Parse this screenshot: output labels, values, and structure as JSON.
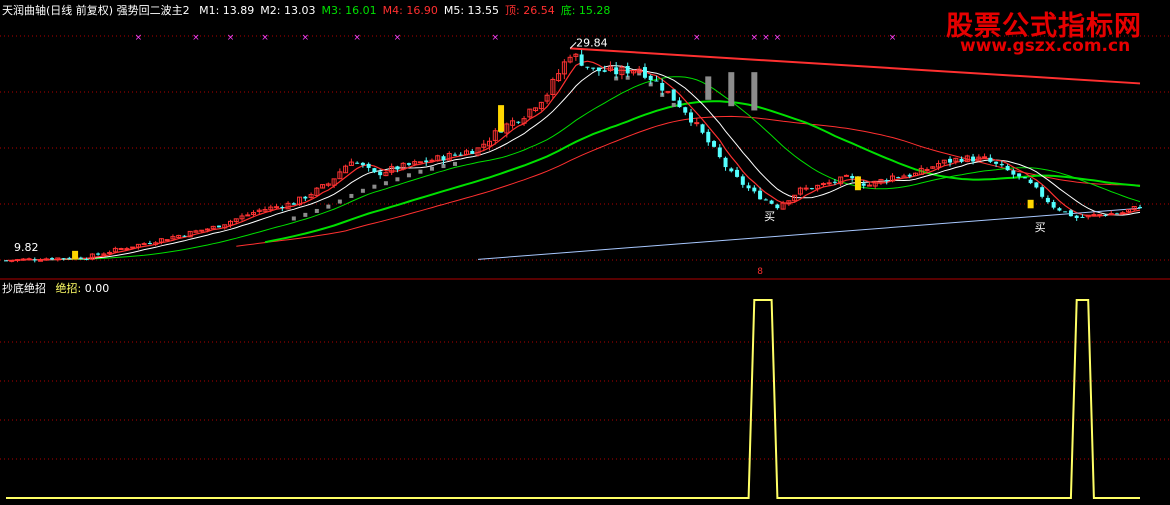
{
  "header_main": {
    "name": "天润曲轴(日线 前复权) 强势回二波主2",
    "items": [
      {
        "label": "M1:",
        "value": "13.89",
        "color": "#ffffff"
      },
      {
        "label": "M2:",
        "value": "13.03",
        "color": "#ffffff"
      },
      {
        "label": "M3:",
        "value": "16.01",
        "color": "#00e000"
      },
      {
        "label": "M4:",
        "value": "16.90",
        "color": "#ff3030"
      },
      {
        "label": "M5:",
        "value": "13.55",
        "color": "#ffffff"
      },
      {
        "label": "顶:",
        "value": "26.54",
        "color": "#ff3030"
      },
      {
        "label": "底:",
        "value": "15.28",
        "color": "#00e000"
      }
    ]
  },
  "header_sub": {
    "name": "抄底绝招",
    "item_label": "绝招:",
    "item_value": "0.00"
  },
  "annotations": {
    "high_label": "29.84",
    "low_label": "9.82",
    "buy_text": "买",
    "marker_digit": "8"
  },
  "watermark": {
    "title": "股票公式指标网",
    "url": "www.gszx.com.cn"
  },
  "colors": {
    "up": "#ff3232",
    "down": "#54ffff",
    "neutral_gray": "#8c8c8c",
    "ma_white": "#ffffff",
    "ma_green": "#00e000",
    "ma_red": "#ff3030",
    "ma_blue": "#a8c8ff",
    "signal_yellow": "#ffff66",
    "grid": "#b00000",
    "magenta": "#ff44ff"
  },
  "chart_data": [
    {
      "type": "candlestick",
      "title": "天润曲轴(日线 前复权)",
      "ylim": [
        9,
        31
      ],
      "annotated_high": 29.84,
      "annotated_low": 9.82,
      "moving_averages": [
        {
          "name": "M1",
          "last": 13.89
        },
        {
          "name": "M2",
          "last": 13.03
        },
        {
          "name": "M3",
          "last": 16.01
        },
        {
          "name": "M4",
          "last": 16.9
        },
        {
          "name": "M5",
          "last": 13.55
        },
        {
          "name": "顶",
          "last": 26.54
        },
        {
          "name": "底",
          "last": 15.28
        }
      ],
      "close_anchors": [
        [
          0,
          9.9
        ],
        [
          8,
          10.1
        ],
        [
          14,
          10.2
        ],
        [
          20,
          11.0
        ],
        [
          28,
          12.0
        ],
        [
          36,
          13.0
        ],
        [
          44,
          14.6
        ],
        [
          50,
          15.3
        ],
        [
          56,
          17.1
        ],
        [
          60,
          19.4
        ],
        [
          64,
          18.0
        ],
        [
          68,
          18.6
        ],
        [
          76,
          19.6
        ],
        [
          82,
          20.4
        ],
        [
          86,
          22.3
        ],
        [
          90,
          23.6
        ],
        [
          94,
          25.6
        ],
        [
          98,
          29.4
        ],
        [
          102,
          27.8
        ],
        [
          106,
          27.6
        ],
        [
          110,
          28.0
        ],
        [
          114,
          26.2
        ],
        [
          118,
          24.0
        ],
        [
          122,
          21.0
        ],
        [
          126,
          18.0
        ],
        [
          130,
          16.2
        ],
        [
          134,
          15.0
        ],
        [
          138,
          16.5
        ],
        [
          142,
          17.0
        ],
        [
          146,
          17.6
        ],
        [
          150,
          17.0
        ],
        [
          154,
          17.8
        ],
        [
          158,
          18.0
        ],
        [
          162,
          19.0
        ],
        [
          166,
          19.5
        ],
        [
          170,
          19.4
        ],
        [
          174,
          18.3
        ],
        [
          178,
          17.0
        ],
        [
          182,
          15.0
        ],
        [
          186,
          13.9
        ],
        [
          190,
          14.2
        ],
        [
          194,
          14.4
        ],
        [
          197,
          15.0
        ]
      ],
      "gray_bar_range": [
        6,
        19
      ]
    },
    {
      "type": "line",
      "title": "抄底绝招",
      "series": [
        {
          "name": "绝招",
          "last": 0.0
        }
      ],
      "ylim": [
        0,
        1
      ],
      "pulses": [
        [
          130,
          133
        ],
        [
          186,
          188
        ]
      ],
      "length": 198
    }
  ]
}
